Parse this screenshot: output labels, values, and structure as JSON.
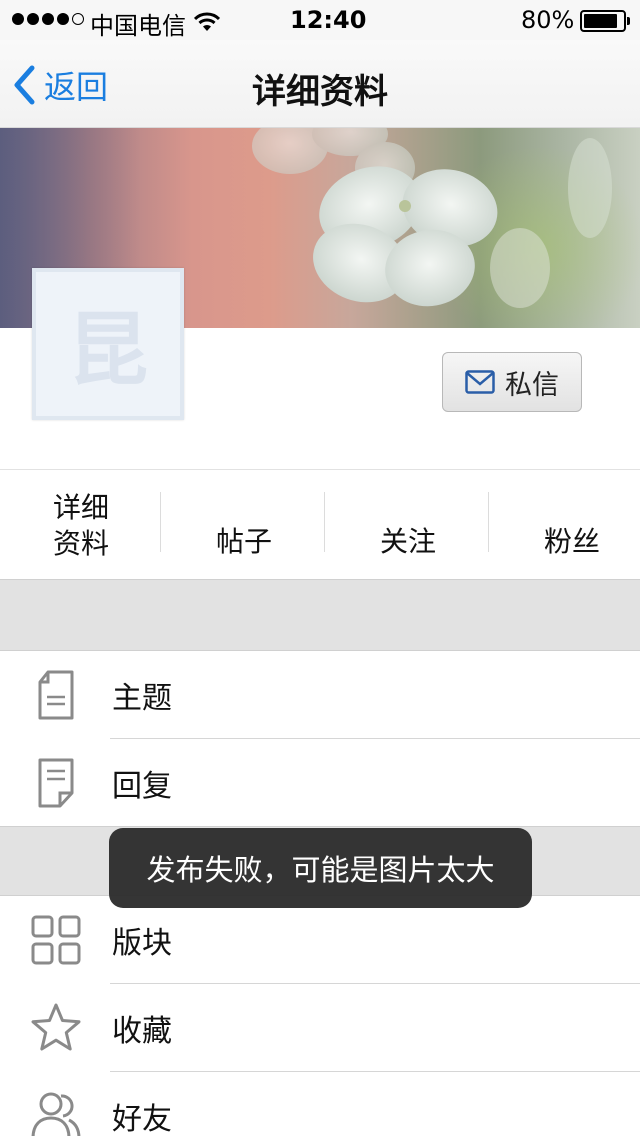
{
  "status_bar": {
    "carrier": "中国电信",
    "time": "12:40",
    "battery": "80%",
    "battery_level": 0.8,
    "signal_bars": 4
  },
  "nav": {
    "back_label": "返回",
    "title": "详细资料"
  },
  "profile": {
    "avatar_placeholder": "昆",
    "message_button": "私信"
  },
  "tabs": {
    "detail_line1": "详细",
    "detail_line2": "资料",
    "posts": "帖子",
    "following": "关注",
    "fans": "粉丝"
  },
  "menu": {
    "topics": "主题",
    "replies": "回复",
    "boards": "版块",
    "favorites": "收藏",
    "friends": "好友"
  },
  "toast": "发布失败，可能是图片太大",
  "colors": {
    "accent": "#1a7ee0",
    "icon_gray": "#8a8a8a",
    "band_gray": "#e2e2e2",
    "toast_bg": "#282828"
  }
}
